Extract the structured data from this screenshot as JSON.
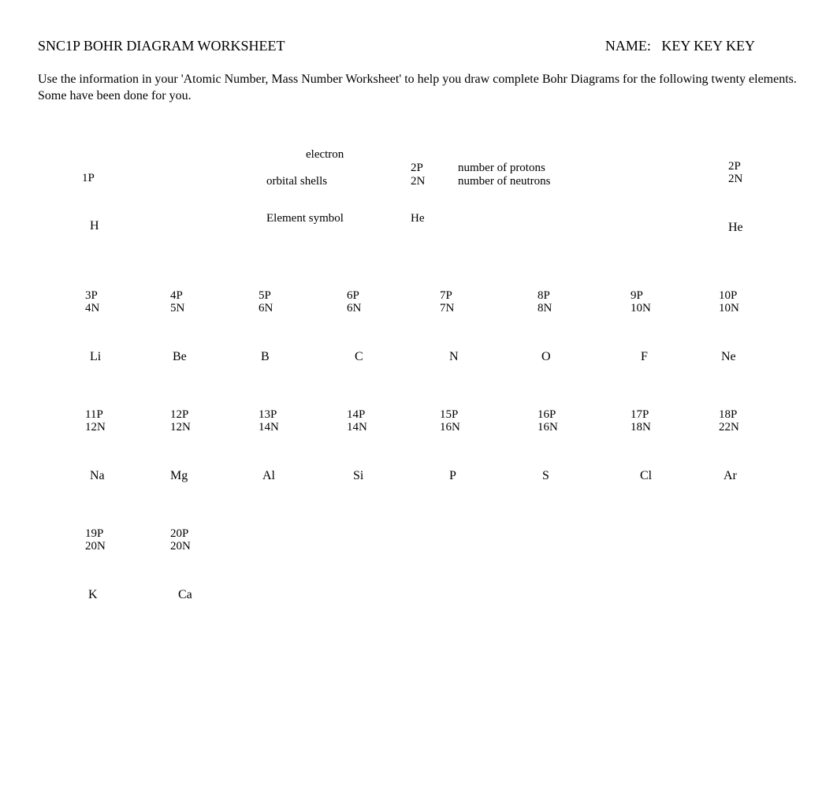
{
  "header": {
    "title": "SNC1P BOHR DIAGRAM WORKSHEET",
    "name_label": "NAME:",
    "name_value": "KEY  KEY  KEY"
  },
  "instructions": "Use the information in your    'Atomic Number, Mass Number Worksheet'          to help you draw complete    Bohr Diagrams     for the following twenty elements.     Some have been done for you.",
  "example": {
    "electron_label": "electron",
    "shells_label": "orbital shells",
    "symbol_label": "Element symbol",
    "protons_label": "number of protons",
    "neutrons_label": "number of neutrons",
    "p": "2P",
    "n": "2N",
    "sym": "He"
  },
  "row1": {
    "h": {
      "p": "1P",
      "n": "",
      "sym": "H"
    },
    "he": {
      "p": "2P",
      "n": "2N",
      "sym": "He"
    }
  },
  "row2": [
    {
      "p": "3P",
      "n": "4N",
      "sym": "Li"
    },
    {
      "p": "4P",
      "n": "5N",
      "sym": "Be"
    },
    {
      "p": "5P",
      "n": "6N",
      "sym": "B"
    },
    {
      "p": "6P",
      "n": "6N",
      "sym": "C"
    },
    {
      "p": "7P",
      "n": "7N",
      "sym": "N"
    },
    {
      "p": "8P",
      "n": "8N",
      "sym": "O"
    },
    {
      "p": "9P",
      "n": "10N",
      "sym": "F"
    },
    {
      "p": "10P",
      "n": "10N",
      "sym": "Ne"
    }
  ],
  "row3": [
    {
      "p": "11P",
      "n": "12N",
      "sym": "Na"
    },
    {
      "p": "12P",
      "n": "12N",
      "sym": "Mg"
    },
    {
      "p": "13P",
      "n": "14N",
      "sym": "Al"
    },
    {
      "p": "14P",
      "n": "14N",
      "sym": "Si"
    },
    {
      "p": "15P",
      "n": "16N",
      "sym": "P"
    },
    {
      "p": "16P",
      "n": "16N",
      "sym": "S"
    },
    {
      "p": "17P",
      "n": "18N",
      "sym": "Cl"
    },
    {
      "p": "18P",
      "n": "22N",
      "sym": "Ar"
    }
  ],
  "row4": [
    {
      "p": "19P",
      "n": "20N",
      "sym": "K"
    },
    {
      "p": "20P",
      "n": "20N",
      "sym": "Ca"
    }
  ]
}
